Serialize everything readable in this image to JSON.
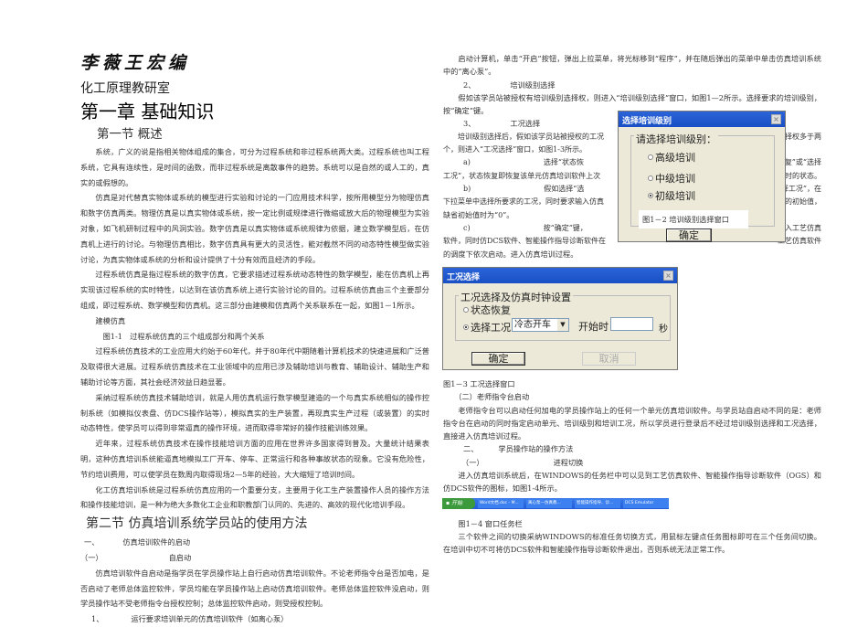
{
  "left": {
    "author": "李薇王宏编",
    "dept": "化工原理教研室",
    "chapter": "第一章 基础知识",
    "sec1": "第一节 概述",
    "p1": "系统，广义的说是指相关物体组成的集合，可分为过程系统和非过程系统两大类。过程系统也叫工程系统，它具有连续性，是时间的函数，而非过程系统是离散事件的趋势。系统可以是自然的或人工的，真实的或假想的。",
    "p2": "仿真是对代替真实物体或系统的模型进行实验和讨论的一门应用技术科学，按所用模型分为物理仿真和数字仿真两类。物理仿真是以真实物体或系统，按一定比例或规律进行微缩或放大后的物理模型为实验对象，如飞机研制过程中的风洞实验。数字仿真是以真实物体或系统规律为依据，建立数学模型后，在仿真机上进行的讨论。与物理仿真相比，数字仿真具有更大的灵活性，能对截然不同的动态特性模型做实验讨论，为真实物体或系统的分析和设计提供了十分有效而且经济的手段。",
    "p3": "过程系统仿真是指过程系统的数字仿真，它要求描述过程系统动态特性的数学模型，能在仿真机上再实现该过程系统的实时特性，以达到在该仿真系统上进行实验讨论的目的。过程系统仿真由三个主要部分组成，即过程系统、数学模型和仿真机。这三部分由建模和仿真两个关系联系在一起，如图1－1所示。",
    "fig_label": "建模仿真",
    "fig1_caption": "图1-1　过程系统仿真的三个组成部分和两个关系",
    "p4": "过程系统仿真技术的工业应用大约始于60年代，并于80年代中期随着计算机技术的快速进展和广泛普及取得很大进展。过程系统仿真技术在工业领域中的应用已涉及辅助培训与教育、辅助设计、辅助生产和辅助讨论等方面，其社会经济效益日趋显著。",
    "p5": "采纳过程系统仿真技术辅助培训，就是人用仿真机运行数学模型建造的一个与真实系统相似的操作控制系统（如模拟仪表盘、仿DCS操作站等），模拟真实的生产装置，再现真实生产过程（或装置）的实时动态特性，使学员可以得到非常逼真的操作环境，进而取得非常好的操作技能训练效果。",
    "p6": "近年来，过程系统仿真技术在操作技能培训方面的应用在世界许多国家得到普及。大量统计结果表明，这种仿真培训系统能逼真地模拟工厂开车、停车、正常运行和各种事故状态的现象。它没有危险性，节约培训费用，可以使学员在数周内取得现场2—5年的经验，大大缩短了培训时间。",
    "p7": "化工仿真培训系统是过程系统仿真应用的一个重要分支，主要用于化工生产装置操作人员的操作方法和操作技能培训，是一种为绝大多数化工企业和职教部门认同的、先进的、高效的现代化培训手段。",
    "sec2": "第二节 仿真培训系统学员站的使用方法",
    "h1_num": "一、",
    "h1": "仿真培训软件的启动",
    "h2_num": "（一）",
    "h2": "自启动",
    "p8": "仿真培训软件自启动是指学员在学员操作站上自行启动仿真培训软件。不论老师指令台是否加电，是否启动了老师总体监控软件，学员均能在学员操作站上启动仿真培训软件。老师总体监控软件没启动，则学员操作站不受老师指令台授权控制；总体监控软件启动，则受授权控制。",
    "h3_num": "1、",
    "h3": "运行要求培训单元的仿真培训软件（如离心泵）"
  },
  "right": {
    "p1": "启动计算机，单击“开启”按钮，弹出上拉菜单，将光标移到“程序”，并在随后弹出的菜单中单击仿真培训系统中的“离心泵”。",
    "h2_num": "2、",
    "h2": "培训级别选择",
    "p2": "假如该学员站被授权有培训级别选择权，则进入“培训级别选择”窗口，如图1—2所示。选择要求的培训级别，按“确定”键。",
    "h3_num": "3、",
    "h3": "工况选择",
    "wrap": [
      {
        "l": "培训级别选择后，假如该学员站被授权的工况",
        "r": "选择权多于两"
      },
      {
        "l": "个，则进入“工况选择”窗口，如图1-3所示。",
        "r": ""
      },
      {
        "l": "a)　　　　　　　　　　选择“状态恢",
        "r": "复”或“选择"
      },
      {
        "l": "工况”，状态恢复即恢复该单元仿真培训软件上次",
        "r": "退出时的状态。"
      },
      {
        "l": "b)　　　　　　　　　　假如选择“选",
        "r": "择工况”，在"
      },
      {
        "l": "下拉菜单中选择所要求的工况，同时要求输入仿真",
        "r": "时钟的初始值，"
      },
      {
        "l": "缺省初始值时为“0”。",
        "r": ""
      },
      {
        "l": "c)　　　　　　　　　　按“确定”键，",
        "r": "进入工艺仿真"
      },
      {
        "l": "软件，同时仿DCS软件、智能操作指导诊断软件在",
        "r": "工艺仿真软件"
      }
    ],
    "p3": "的调度下依次启动。进入仿真培训过程。",
    "fig3_caption": "图1－3 工况选择窗口",
    "h4": "（二）老师指令台启动",
    "p4": "老师指令台可以启动任何加电的学员操作站上的任何一个单元仿真培训软件。与学员站自启动不同的是：老师指令台在启动的同时指定启动单元、培训级别和培训工况，所以学员进行登录后不经过培训级别选择和工况选择，直接进入仿真培训过程。",
    "h5_num": "二、",
    "h5": "学员操作站的操作方法",
    "h6_num": "（一）",
    "h6": "进程切换",
    "p5": "进入仿真培训系统后，在WINDOWS的任务栏中可以见到工艺仿真软件、智能操作指导诊断软件（OGS）和仿DCS软件的图标，如图1-4所示。",
    "fig4_caption": "图1－4 窗口任务栏",
    "p6": "三个软件之间的切换采纳WINDOWS的标准任务切换方式，用鼠标左键点任务图标即可在三个任务间切换。在培训中切不可将仿DCS软件和智能操作指导诊断软件退出，否则系统无法正常工作。"
  },
  "dialog_level": {
    "title": "选择培训级别",
    "group": "请选择培训级别：",
    "options": [
      "高级培训",
      "中级培训",
      "初级培训"
    ],
    "selected": 2,
    "caption": "图1－2 培训级别选择窗口",
    "ok": "确定"
  },
  "dialog_mode": {
    "title": "工况选择",
    "group": "工况选择及仿真时钟设置",
    "opt1": "状态恢复",
    "opt2": "选择工况",
    "select_value": "冷态开车",
    "start_label": "开始时",
    "start_value": "",
    "unit": "秒",
    "ok": "确定",
    "cancel": "取消"
  },
  "taskbar": {
    "start": "开始",
    "items": [
      "Word文档.doc - M...",
      "离心泵—仿真教...",
      "智能操作指导、诊...",
      "DCS Emulator"
    ]
  }
}
